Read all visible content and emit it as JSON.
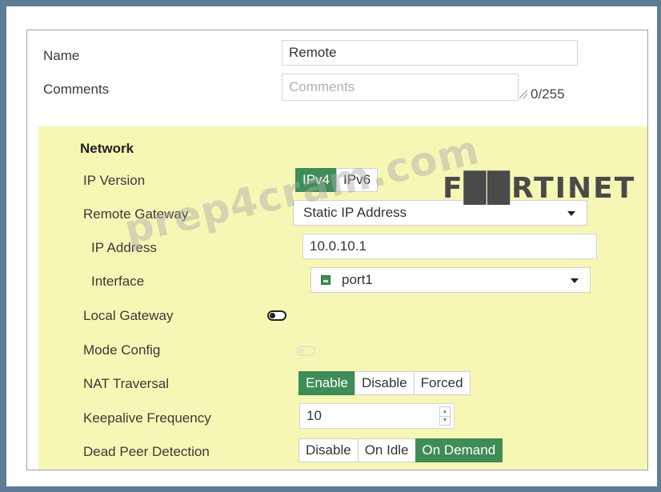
{
  "form": {
    "name_label": "Name",
    "name_value": "Remote",
    "comments_label": "Comments",
    "comments_placeholder": "Comments",
    "comments_counter": "0/255"
  },
  "network": {
    "section_title": "Network",
    "ip_version_label": "IP Version",
    "ip_version_options": [
      "IPv4",
      "IPv6"
    ],
    "ip_version_selected": "IPv4",
    "remote_gateway_label": "Remote Gateway",
    "remote_gateway_value": "Static IP Address",
    "ip_address_label": "IP Address",
    "ip_address_value": "10.0.10.1",
    "interface_label": "Interface",
    "interface_value": "port1",
    "interface_icon": "port-icon",
    "local_gateway_label": "Local Gateway",
    "local_gateway_enabled": false,
    "mode_config_label": "Mode Config",
    "mode_config_enabled": false,
    "nat_traversal_label": "NAT Traversal",
    "nat_traversal_options": [
      "Enable",
      "Disable",
      "Forced"
    ],
    "nat_traversal_selected": "Enable",
    "keepalive_label": "Keepalive Frequency",
    "keepalive_value": "10",
    "dpd_label": "Dead Peer Detection",
    "dpd_options": [
      "Disable",
      "On Idle",
      "On Demand"
    ],
    "dpd_selected": "On Demand"
  },
  "overlay": {
    "brand": "F██RTINET",
    "watermark": "prep4cram.com"
  },
  "colors": {
    "active_green": "#3f8d56",
    "section_background": "#f6f7b4",
    "outer_background": "#5e7d94"
  }
}
